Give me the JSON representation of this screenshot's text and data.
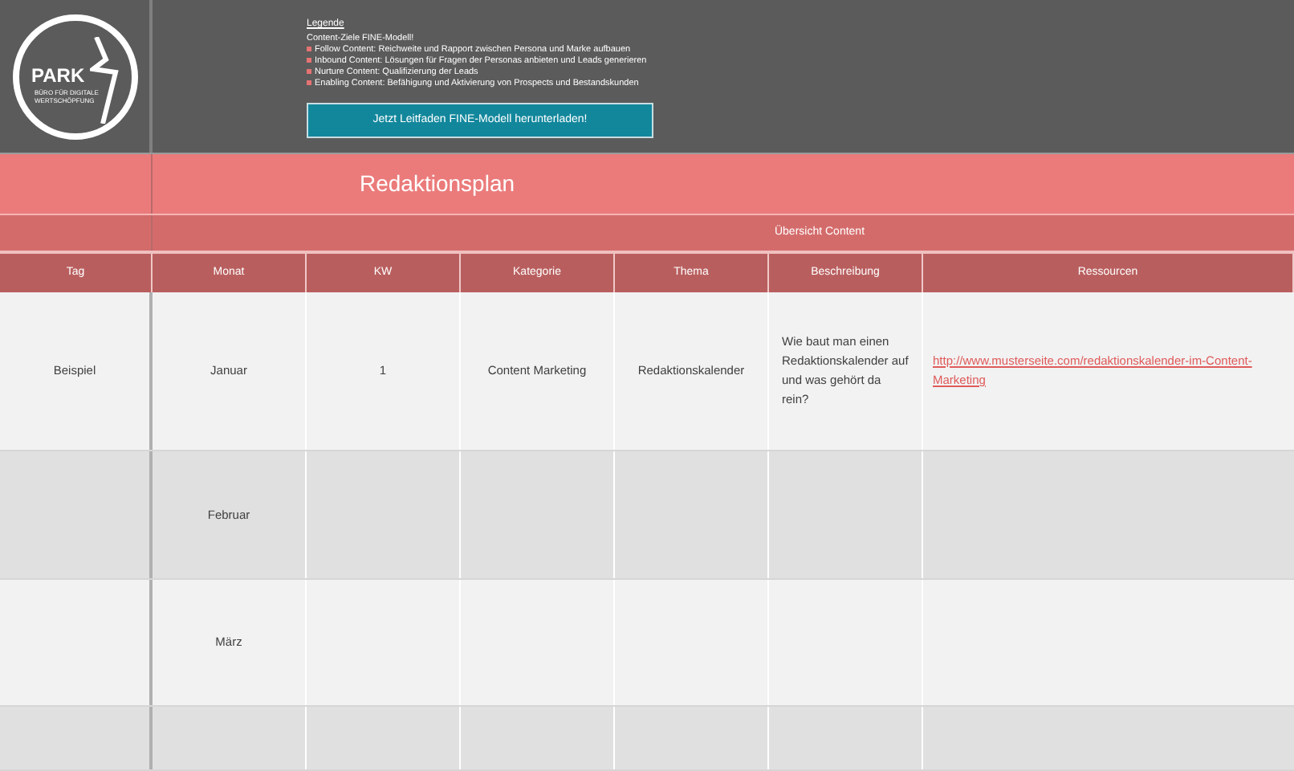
{
  "logo": {
    "wordmark": "PARK",
    "tagline": "BÜRO FÜR DIGITALE WERTSCHÖPFUNG"
  },
  "legend": {
    "heading": "Legende",
    "intro": "Content-Ziele FINE-Modell!",
    "items": [
      "Follow Content: Reichweite und Rapport zwischen Persona und Marke aufbauen",
      "Inbound Content: Lösungen für Fragen der Personas anbieten und Leads generieren",
      "Nurture Content: Qualifizierung der Leads",
      "Enabling Content: Befähigung und Aktivierung von Prospects und Bestandskunden"
    ]
  },
  "download_button": "Jetzt Leitfaden FINE-Modell herunterladen!",
  "title": "Redaktionsplan",
  "group_header": "Übersicht Content",
  "table": {
    "columns": [
      "Tag",
      "Monat",
      "KW",
      "Kategorie",
      "Thema",
      "Beschreibung",
      "Ressourcen"
    ],
    "rows": [
      {
        "cells": [
          "Beispiel",
          "Januar",
          "1",
          "Content Marketing",
          "Redaktionskalender",
          "Wie baut man einen Redaktionskalender auf und was gehört da rein?"
        ],
        "link": "http://www.musterseite.com/redaktionskalender-im-Content-Marketing"
      },
      {
        "cells": [
          "",
          "Februar",
          "",
          "",
          "",
          ""
        ]
      },
      {
        "cells": [
          "",
          "März",
          "",
          "",
          "",
          ""
        ]
      },
      {
        "cells": [
          "",
          "",
          "",
          "",
          "",
          ""
        ]
      }
    ]
  }
}
